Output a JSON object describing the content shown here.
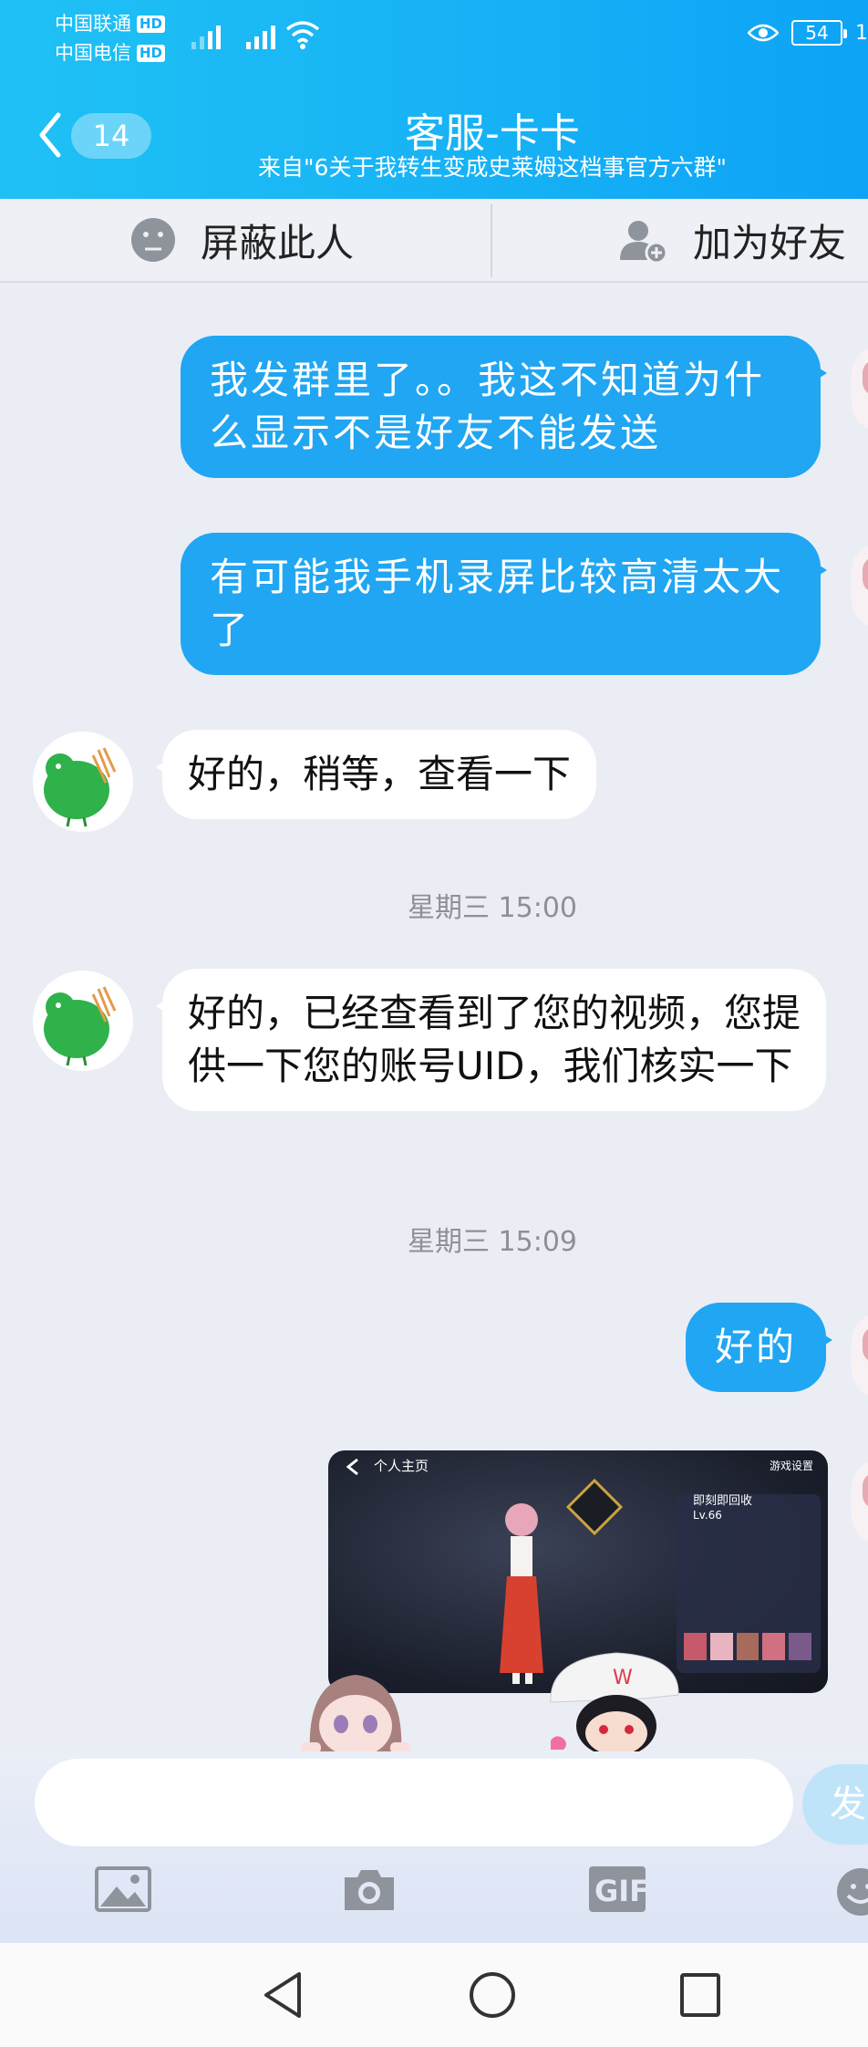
{
  "status_bar": {
    "carrier1": "中国联通",
    "carrier2": "中国电信",
    "hd_label": "HD",
    "battery": "54",
    "time_fragment": "1"
  },
  "header": {
    "unread_count": "14",
    "title": "客服-卡卡",
    "subtitle": "来自\"6关于我转生变成史莱姆这档事官方六群\""
  },
  "actions": {
    "block_label": "屏蔽此人",
    "add_friend_label": "加为好友"
  },
  "messages": [
    {
      "sender": "me",
      "text": "我发群里了。。我这不知道为什么显示不是好友不能发送"
    },
    {
      "sender": "me",
      "text": "有可能我手机录屏比较高清太大了"
    },
    {
      "sender": "other",
      "text": "好的，稍等，查看一下"
    },
    {
      "sender": "other",
      "text": "好的，已经查看到了您的视频，您提供一下您的账号UID，我们核实一下"
    },
    {
      "sender": "me",
      "text": "好的"
    }
  ],
  "timestamps": [
    "星期三 15:00",
    "星期三 15:09"
  ],
  "screenshot_image": {
    "page_title": "个人主页",
    "settings_label": "游戏设置",
    "player_name": "即刻即回收",
    "level": "Lv.66"
  },
  "input": {
    "value": "",
    "send_label": "发"
  },
  "colors": {
    "header_gradient_start": "#1fc1f5",
    "header_gradient_end": "#0da3f6",
    "my_bubble": "#20a6f3",
    "other_bubble": "#ffffff",
    "chat_background": "#ebedf5"
  },
  "icons": [
    "back-icon",
    "block-icon",
    "add-friend-icon",
    "image-icon",
    "camera-icon",
    "gif-icon",
    "emoji-icon",
    "nav-back-icon",
    "nav-home-icon",
    "nav-recent-icon"
  ]
}
